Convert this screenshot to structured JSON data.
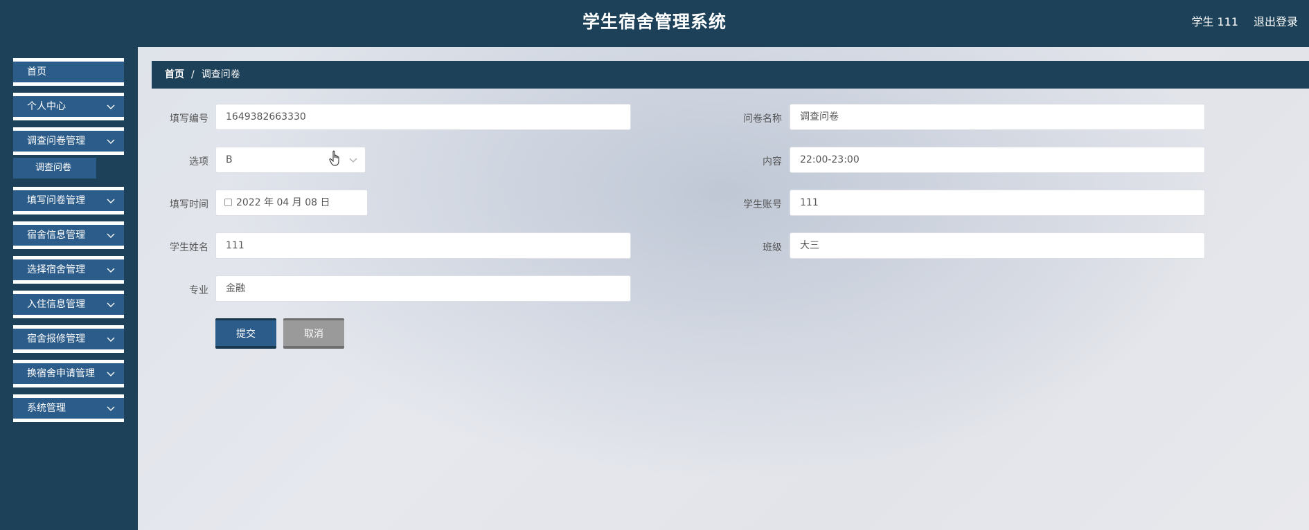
{
  "header": {
    "title": "学生宿舍管理系统",
    "user": "学生 111",
    "logout": "退出登录"
  },
  "sidebar": {
    "items": [
      {
        "label": "首页",
        "has_children": false
      },
      {
        "label": "个人中心",
        "has_children": true
      },
      {
        "label": "调查问卷管理",
        "has_children": true,
        "expanded": true,
        "children": [
          "调查问卷"
        ]
      },
      {
        "label": "填写问卷管理",
        "has_children": true
      },
      {
        "label": "宿舍信息管理",
        "has_children": true
      },
      {
        "label": "选择宿舍管理",
        "has_children": true
      },
      {
        "label": "入住信息管理",
        "has_children": true
      },
      {
        "label": "宿舍报修管理",
        "has_children": true
      },
      {
        "label": "换宿舍申请管理",
        "has_children": true
      },
      {
        "label": "系统管理",
        "has_children": true
      }
    ]
  },
  "breadcrumb": {
    "home": "首页",
    "separator": "/",
    "current": "调查问卷"
  },
  "form": {
    "fill_no": {
      "label": "填写编号",
      "value": "1649382663330"
    },
    "questionnaire_name": {
      "label": "问卷名称",
      "value": "调查问卷"
    },
    "option": {
      "label": "选项",
      "value": "B"
    },
    "content": {
      "label": "内容",
      "value": "22:00-23:00"
    },
    "fill_time": {
      "label": "填写时间",
      "value": "2022 年 04 月 08 日"
    },
    "student_account": {
      "label": "学生账号",
      "value": "111"
    },
    "student_name": {
      "label": "学生姓名",
      "value": "111"
    },
    "class": {
      "label": "班级",
      "value": "大三"
    },
    "major": {
      "label": "专业",
      "value": "金融"
    },
    "submit": "提交",
    "cancel": "取消"
  },
  "colors": {
    "primary": "#1c4158",
    "menu": "#2c5c8a",
    "cancel": "#9a9a9a"
  }
}
